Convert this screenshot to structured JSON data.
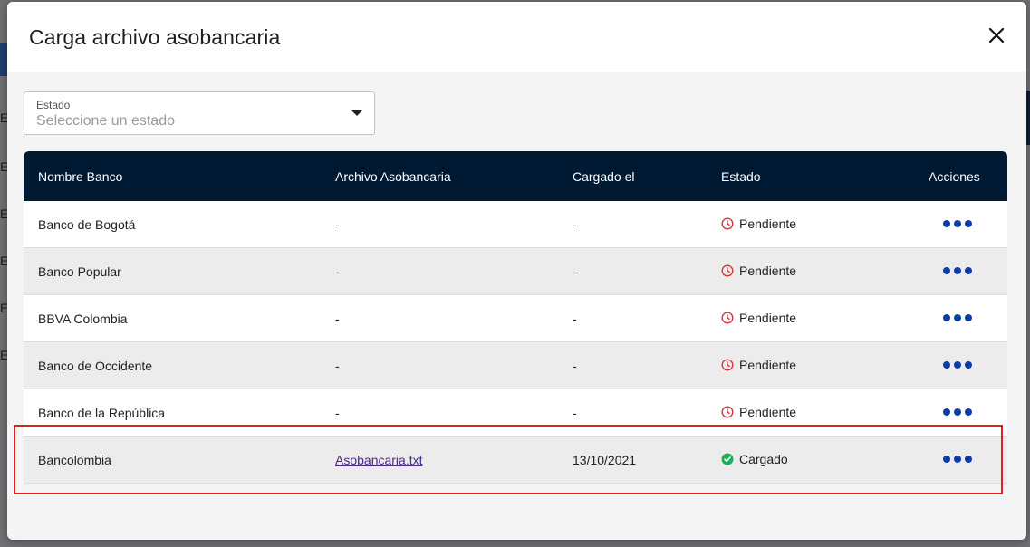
{
  "modal": {
    "title": "Carga archivo asobancaria",
    "close_icon": "close-icon"
  },
  "filter": {
    "label": "Estado",
    "placeholder": "Seleccione un estado"
  },
  "table": {
    "headers": [
      "Nombre Banco",
      "Archivo Asobancaria",
      "Cargado el",
      "Estado",
      "Acciones"
    ],
    "rows": [
      {
        "bank": "Banco de Bogotá",
        "file": "-",
        "date": "-",
        "status": "Pendiente"
      },
      {
        "bank": "Banco Popular",
        "file": "-",
        "date": "-",
        "status": "Pendiente"
      },
      {
        "bank": "BBVA Colombia",
        "file": "-",
        "date": "-",
        "status": "Pendiente"
      },
      {
        "bank": "Banco de Occidente",
        "file": "-",
        "date": "-",
        "status": "Pendiente"
      },
      {
        "bank": "Banco de la República",
        "file": "-",
        "date": "-",
        "status": "Pendiente"
      },
      {
        "bank": "Bancolombia",
        "file": "Asobancaria.txt",
        "date": "13/10/2021",
        "status": "Cargado"
      }
    ]
  },
  "background": {
    "row_letters": [
      "E",
      "E",
      "E",
      "E",
      "E",
      "E"
    ]
  },
  "colors": {
    "header_bg": "#011a33",
    "pending_icon": "#d9363e",
    "loaded_icon": "#1fae5c",
    "actions_dots": "#0a3fa8",
    "highlight": "#e02020"
  }
}
